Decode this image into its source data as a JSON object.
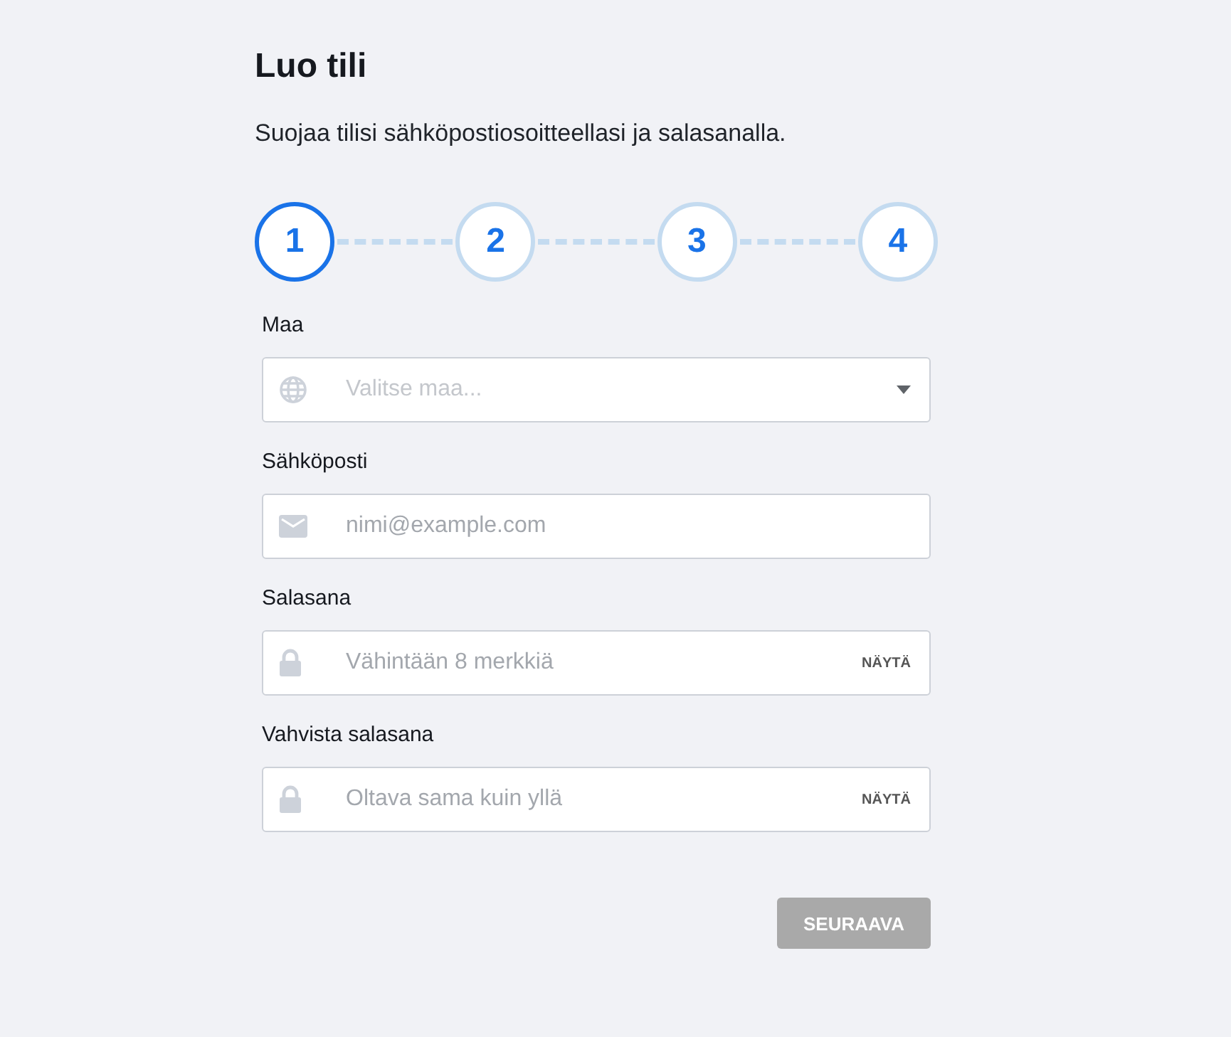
{
  "title": "Luo tili",
  "subtitle": "Suojaa tilisi sähköpostiosoitteellasi ja salasanalla.",
  "steps": [
    {
      "label": "1",
      "selected": true
    },
    {
      "label": "2",
      "selected": false
    },
    {
      "label": "3",
      "selected": false
    },
    {
      "label": "4",
      "selected": false
    }
  ],
  "fields": [
    {
      "kind": "select",
      "label": "Maa",
      "placeholder": "Valitse maa..."
    },
    {
      "kind": "email",
      "label": "Sähköposti",
      "placeholder": "nimi@example.com"
    },
    {
      "kind": "password",
      "label": "Salasana",
      "placeholder": "Vähintään 8 merkkiä",
      "toggle": "NÄYTÄ"
    },
    {
      "kind": "password",
      "label": "Vahvista salasana",
      "placeholder": "Oltava sama kuin yllä",
      "toggle": "NÄYTÄ"
    }
  ],
  "next_button": {
    "label": "SEURAAVA",
    "disabled": true
  }
}
